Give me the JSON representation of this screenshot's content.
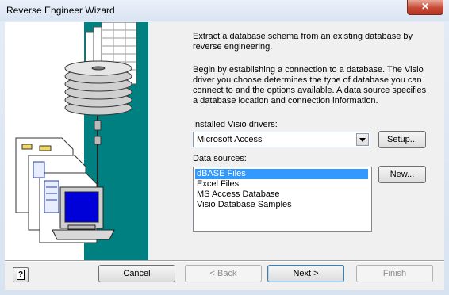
{
  "window": {
    "title": "Reverse Engineer Wizard",
    "close_label": "✕"
  },
  "intro": {
    "line1": "Extract a database schema from an existing database by reverse engineering.",
    "line2": "Begin by establishing a connection to a database.  The Visio driver you choose determines the type of database you can connect to and the options available.  A data source specifies a database location and connection information."
  },
  "drivers": {
    "label": "Installed Visio drivers:",
    "selected": "Microsoft Access",
    "setup_label": "Setup..."
  },
  "sources": {
    "label": "Data sources:",
    "new_label": "New...",
    "items": [
      "dBASE Files",
      "Excel Files",
      "MS Access Database",
      "Visio Database Samples"
    ],
    "selected_index": 0
  },
  "footer": {
    "help_glyph": "?",
    "cancel": "Cancel",
    "back": "< Back",
    "next": "Next >",
    "finish": "Finish"
  },
  "colors": {
    "art_panel": "#008080",
    "selection": "#3399ff"
  },
  "icons": [
    "close-icon",
    "database-stack-icon",
    "document-icon",
    "computer-icon",
    "help-icon",
    "dropdown-arrow-icon"
  ]
}
